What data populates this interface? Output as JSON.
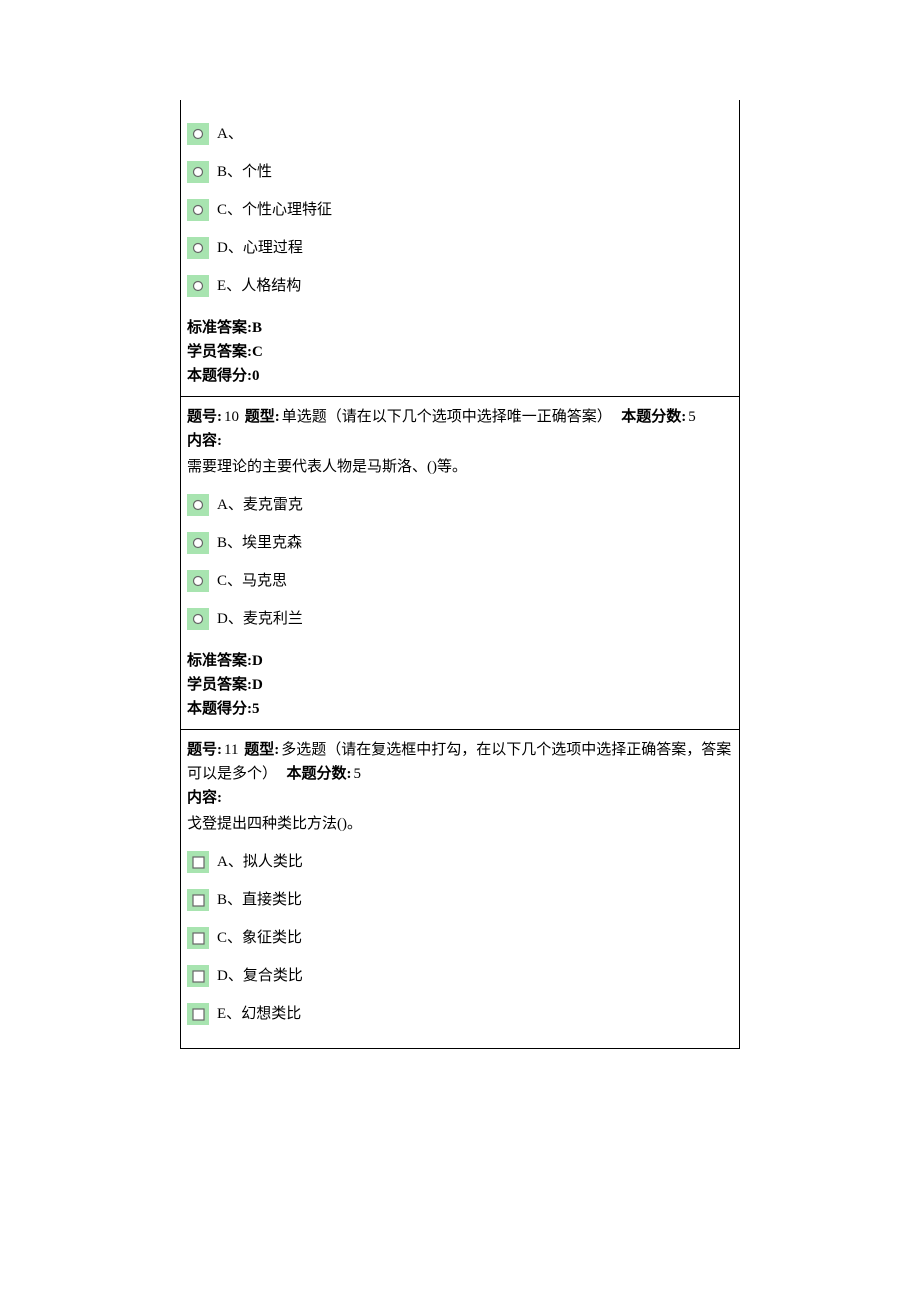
{
  "labels": {
    "question_no": "题号:",
    "question_type": "题型:",
    "question_points": "本题分数:",
    "content": "内容:",
    "standard_answer": "标准答案:",
    "student_answer": "学员答案:",
    "score": "本题得分:"
  },
  "q9": {
    "options": [
      {
        "letter": "A",
        "text": ""
      },
      {
        "letter": "B",
        "text": "个性"
      },
      {
        "letter": "C",
        "text": "个性心理特征"
      },
      {
        "letter": "D",
        "text": "心理过程"
      },
      {
        "letter": "E",
        "text": "人格结构"
      }
    ],
    "standard_answer": "B",
    "student_answer": "C",
    "score": "0"
  },
  "q10": {
    "number": "10",
    "type": "单选题（请在以下几个选项中选择唯一正确答案）",
    "points": "5",
    "text": "需要理论的主要代表人物是马斯洛、()等。",
    "options": [
      {
        "letter": "A",
        "text": "麦克雷克"
      },
      {
        "letter": "B",
        "text": "埃里克森"
      },
      {
        "letter": "C",
        "text": "马克思"
      },
      {
        "letter": "D",
        "text": "麦克利兰"
      }
    ],
    "standard_answer": "D",
    "student_answer": "D",
    "score": "5"
  },
  "q11": {
    "number": "11",
    "type": "多选题（请在复选框中打勾，在以下几个选项中选择正确答案，答案可以是多个）",
    "points": "5",
    "text": "戈登提出四种类比方法()。",
    "options": [
      {
        "letter": "A",
        "text": "拟人类比"
      },
      {
        "letter": "B",
        "text": "直接类比"
      },
      {
        "letter": "C",
        "text": "象征类比"
      },
      {
        "letter": "D",
        "text": "复合类比"
      },
      {
        "letter": "E",
        "text": "幻想类比"
      }
    ]
  }
}
